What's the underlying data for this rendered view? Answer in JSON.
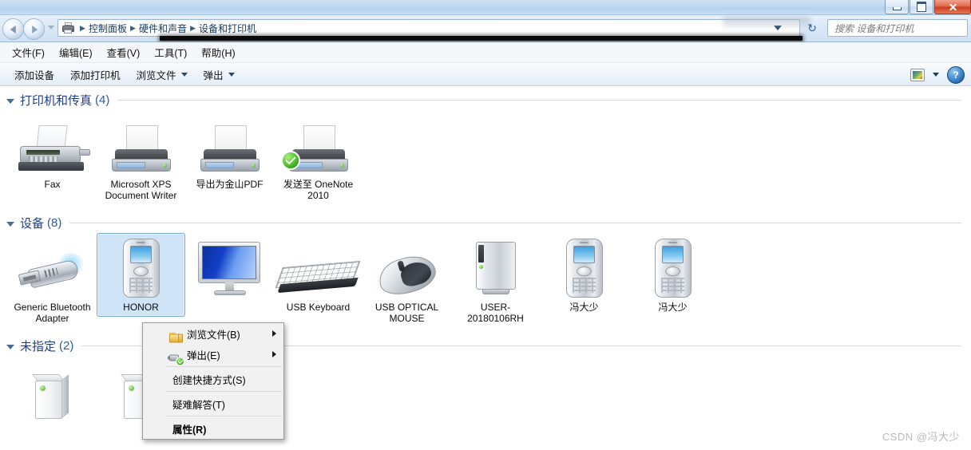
{
  "window": {
    "buttons": {
      "minimize": "—",
      "maximize": "❐",
      "close": "✕"
    }
  },
  "nav": {
    "back_title": "后退",
    "forward_title": "前进",
    "breadcrumb": [
      "控制面板",
      "硬件和声音",
      "设备和打印机"
    ],
    "separator": "▶",
    "refresh_glyph": "↻",
    "search": {
      "placeholder": "搜索 设备和打印机",
      "value": ""
    }
  },
  "menubar": {
    "items": [
      "文件(F)",
      "编辑(E)",
      "查看(V)",
      "工具(T)",
      "帮助(H)"
    ]
  },
  "toolbar": {
    "items": [
      {
        "label": "添加设备",
        "caret": false
      },
      {
        "label": "添加打印机",
        "caret": false
      },
      {
        "label": "浏览文件",
        "caret": true
      },
      {
        "label": "弹出",
        "caret": true
      }
    ],
    "help_label": "?"
  },
  "groups": [
    {
      "key": "printers",
      "title": "打印机和传真",
      "count": "(4)",
      "items": [
        {
          "label": "Fax",
          "icon": "fax-icon",
          "default": false,
          "selected": false
        },
        {
          "label": "Microsoft XPS Document Writer",
          "icon": "printer-icon",
          "default": false,
          "selected": false
        },
        {
          "label": "导出为金山PDF",
          "icon": "printer-icon",
          "default": false,
          "selected": false
        },
        {
          "label": "发送至 OneNote 2010",
          "icon": "printer-icon",
          "default": true,
          "selected": false
        }
      ]
    },
    {
      "key": "devices",
      "title": "设备",
      "count": "(8)",
      "items": [
        {
          "label": "Generic Bluetooth Adapter",
          "icon": "bluetooth-dongle-icon",
          "default": false,
          "selected": false
        },
        {
          "label": "HONOR",
          "icon": "phone-icon",
          "default": false,
          "selected": true
        },
        {
          "label": "",
          "icon": "monitor-icon",
          "default": false,
          "selected": false
        },
        {
          "label": "USB Keyboard",
          "icon": "keyboard-icon",
          "default": false,
          "selected": false
        },
        {
          "label": "USB OPTICAL MOUSE",
          "icon": "mouse-icon",
          "default": false,
          "selected": false
        },
        {
          "label": "USER-20180106RH",
          "icon": "computer-tower-icon",
          "default": false,
          "selected": false
        },
        {
          "label": "冯大少",
          "icon": "phone-icon",
          "default": false,
          "selected": false
        },
        {
          "label": "冯大少",
          "icon": "phone-icon",
          "default": false,
          "selected": false
        }
      ]
    },
    {
      "key": "unspecified",
      "title": "未指定",
      "count": "(2)",
      "items": [
        {
          "label": "",
          "icon": "generic-device-icon",
          "default": false,
          "selected": false
        },
        {
          "label": "",
          "icon": "generic-device-icon",
          "default": false,
          "selected": false
        }
      ]
    }
  ],
  "context_menu": {
    "rows": [
      {
        "label": "浏览文件(B)",
        "icon": "folder-icon",
        "submenu": true,
        "bold": false,
        "separator_after": false
      },
      {
        "label": "弹出(E)",
        "icon": "eject-icon",
        "submenu": true,
        "bold": false,
        "separator_after": true
      },
      {
        "label": "创建快捷方式(S)",
        "icon": "",
        "submenu": false,
        "bold": false,
        "separator_after": true
      },
      {
        "label": "疑难解答(T)",
        "icon": "",
        "submenu": false,
        "bold": false,
        "separator_after": true
      },
      {
        "label": "属性(R)",
        "icon": "",
        "submenu": false,
        "bold": true,
        "separator_after": false
      }
    ]
  },
  "watermark": "CSDN @冯大少",
  "colors": {
    "group_title": "#1f3f87",
    "selection_fill": "#cfe4f7",
    "selection_border": "#7aa9d6",
    "titlebar": "#bed8f0",
    "close_button": "#cb3f1d"
  }
}
